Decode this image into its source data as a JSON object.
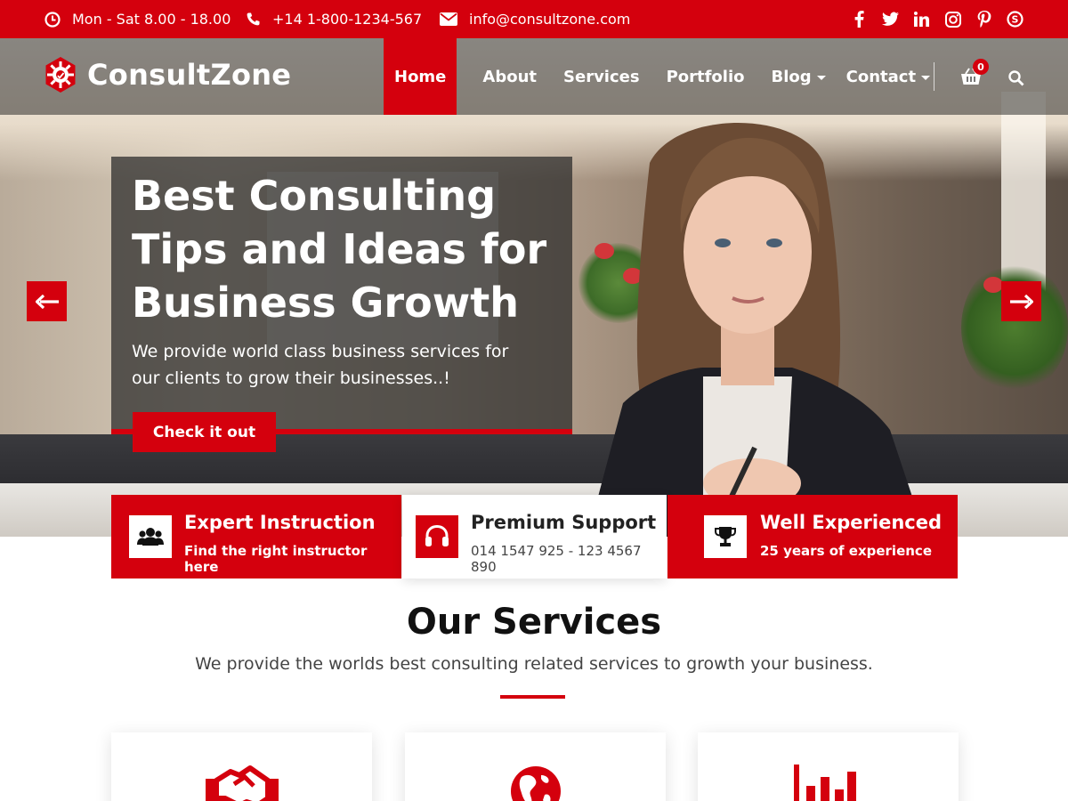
{
  "topbar": {
    "hours": "Mon - Sat 8.00 - 18.00",
    "phone": "+14 1-800-1234-567",
    "email": "info@consultzone.com",
    "socials": [
      "facebook-icon",
      "twitter-icon",
      "linkedin-icon",
      "instagram-icon",
      "pinterest-icon",
      "skype-icon"
    ]
  },
  "header": {
    "logo_text": "ConsultZone",
    "nav": [
      {
        "label": "Home",
        "active": true
      },
      {
        "label": "About"
      },
      {
        "label": "Services"
      },
      {
        "label": "Portfolio"
      },
      {
        "label": "Blog",
        "dropdown": true
      },
      {
        "label": "Contact",
        "dropdown": true
      }
    ],
    "cart_count": "0"
  },
  "hero": {
    "title_lines": [
      "Best Consulting",
      "Tips and Ideas for",
      "Business Growth"
    ],
    "subtitle_lines": [
      "We provide world class business services for",
      "our clients to grow their businesses..!"
    ],
    "cta_label": "Check it out"
  },
  "features": [
    {
      "title": "Expert Instruction",
      "subtitle": "Find the right instructor here",
      "icon": "users-icon"
    },
    {
      "title": "Premium Support",
      "subtitle": "014 1547 925 - 123 4567 890",
      "icon": "headset-icon"
    },
    {
      "title": "Well Experienced",
      "subtitle": "25 years of experience",
      "icon": "trophy-icon"
    }
  ],
  "services": {
    "title": "Our Services",
    "subtitle": "We provide the worlds best consulting related services to growth your business.",
    "cards": [
      {
        "icon": "handshake-icon"
      },
      {
        "icon": "globe-icon"
      },
      {
        "icon": "bar-chart-icon"
      }
    ]
  },
  "colors": {
    "accent": "#d4000d",
    "overlay": "#282828"
  }
}
